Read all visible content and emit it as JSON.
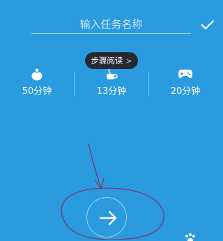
{
  "task": {
    "placeholder": "输入任务名称",
    "value": ""
  },
  "tooltip": {
    "label": "步骤阅读",
    "arrow": ">"
  },
  "timers": [
    {
      "icon": "tomato-icon",
      "label": "50分钟"
    },
    {
      "icon": "coffee-icon",
      "label": "13分钟"
    },
    {
      "icon": "gamepad-icon",
      "label": "20分钟"
    }
  ],
  "colors": {
    "background": "#2b9be0",
    "tooltip_bg": "#242a30",
    "annotation": "#7a3b68"
  }
}
